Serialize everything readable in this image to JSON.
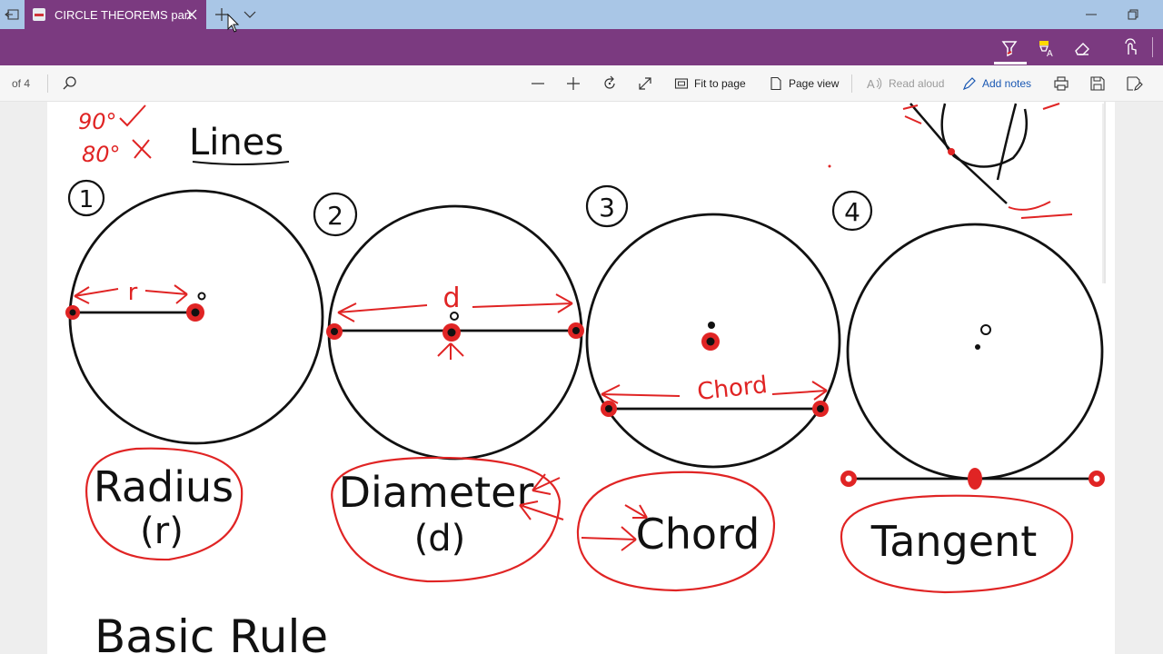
{
  "browser": {
    "tab_title": "CIRCLE THEOREMS part"
  },
  "pdf_toolbar": {
    "page_count": "of 4",
    "fit_to_page": "Fit to page",
    "page_view": "Page view",
    "read_aloud": "Read aloud",
    "add_notes": "Add notes"
  },
  "document": {
    "scribble_top": "90°",
    "scribble_bottom": "80°",
    "heading": "Lines",
    "figures": [
      {
        "number": "1",
        "label": "Radius",
        "sub": "(r)",
        "inline": "r"
      },
      {
        "number": "2",
        "label": "Diameter",
        "sub": "(d)",
        "inline": "d"
      },
      {
        "number": "3",
        "label": "Chord",
        "sub": "",
        "inline": "Chord"
      },
      {
        "number": "4",
        "label": "Tangent",
        "sub": "",
        "inline": ""
      }
    ],
    "footer_heading": "Basic Rule"
  },
  "colors": {
    "tab_accent": "#7b3a80",
    "ink_red": "#e02424",
    "ink_black": "#111111"
  }
}
